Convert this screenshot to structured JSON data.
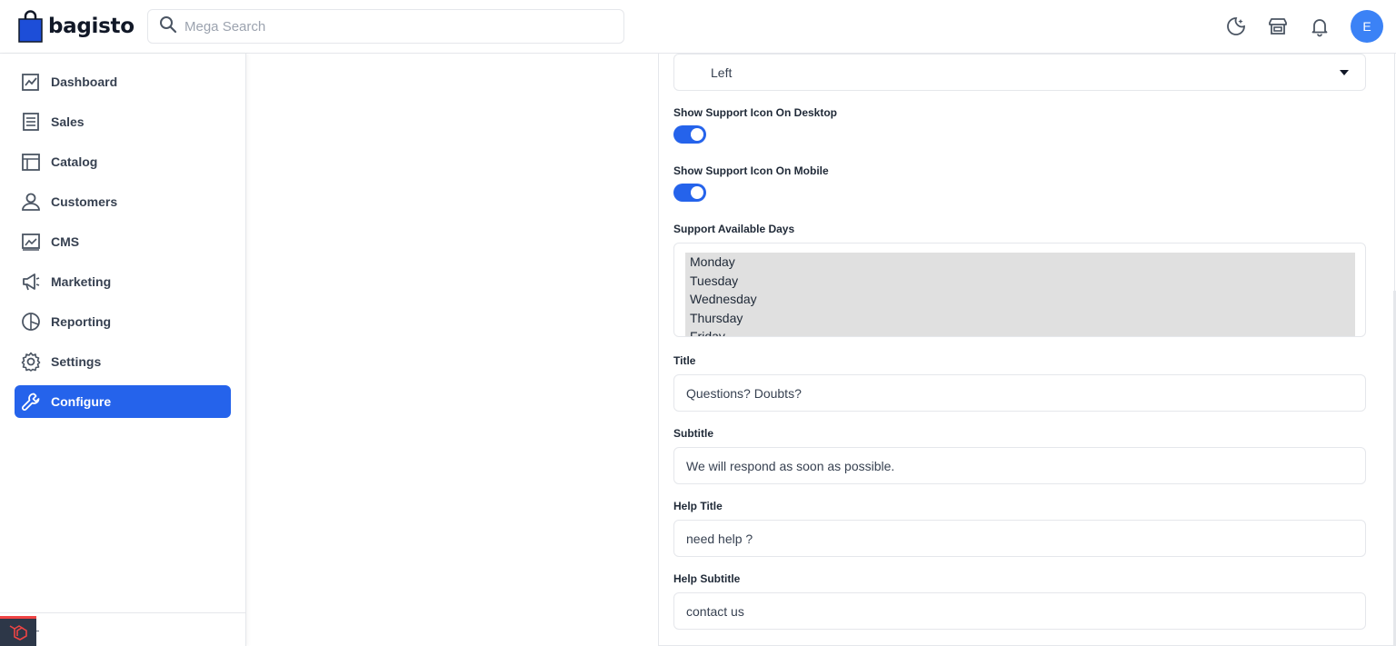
{
  "header": {
    "brand": "bagisto",
    "search_placeholder": "Mega Search",
    "avatar_initial": "E"
  },
  "sidebar": {
    "items": [
      {
        "label": "Dashboard",
        "icon": "dashboard-icon"
      },
      {
        "label": "Sales",
        "icon": "sales-icon"
      },
      {
        "label": "Catalog",
        "icon": "catalog-icon"
      },
      {
        "label": "Customers",
        "icon": "customers-icon"
      },
      {
        "label": "CMS",
        "icon": "cms-icon"
      },
      {
        "label": "Marketing",
        "icon": "marketing-icon"
      },
      {
        "label": "Reporting",
        "icon": "reporting-icon"
      },
      {
        "label": "Settings",
        "icon": "settings-icon"
      },
      {
        "label": "Configure",
        "icon": "configure-icon",
        "active": true
      }
    ]
  },
  "form": {
    "position_value": "Left",
    "show_desktop_label": "Show Support Icon On Desktop",
    "show_desktop_on": true,
    "show_mobile_label": "Show Support Icon On Mobile",
    "show_mobile_on": true,
    "days_label": "Support Available Days",
    "days": [
      "Monday",
      "Tuesday",
      "Wednesday",
      "Thursday",
      "Friday"
    ],
    "title_label": "Title",
    "title_value": "Questions? Doubts?",
    "subtitle_label": "Subtitle",
    "subtitle_value": "We will respond as soon as possible.",
    "help_title_label": "Help Title",
    "help_title_value": "need help ?",
    "help_subtitle_label": "Help Subtitle",
    "help_subtitle_value": "contact us"
  },
  "colors": {
    "accent": "#2563eb",
    "avatar": "#3b82f6",
    "brand_bag": "#1d4ed8"
  }
}
